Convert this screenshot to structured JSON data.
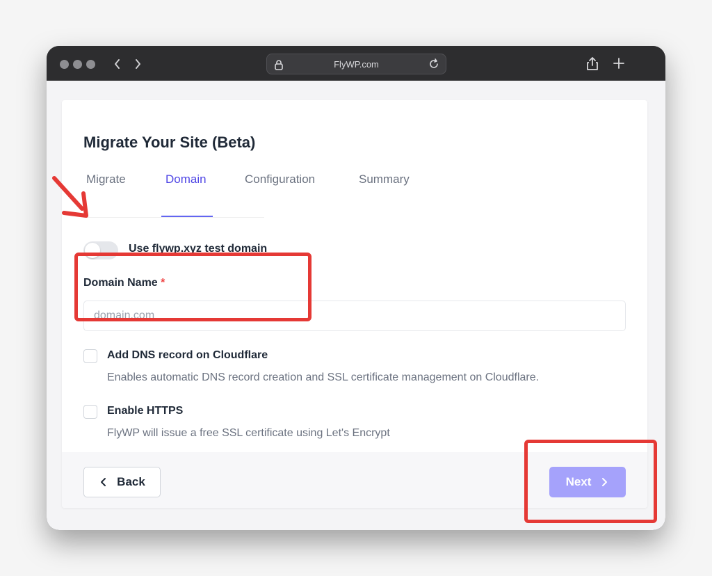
{
  "browser": {
    "url": "FlyWP.com",
    "icons": {
      "back": "chevron-left-icon",
      "forward": "chevron-right-icon",
      "lock": "lock-icon",
      "reload": "reload-icon",
      "share": "share-icon",
      "new_tab": "plus-icon",
      "tabs": "tabs-icon"
    }
  },
  "page": {
    "title": "Migrate Your Site (Beta)",
    "tabs": [
      {
        "label": "Migrate",
        "active": false
      },
      {
        "label": "Domain",
        "active": true
      },
      {
        "label": "Configuration",
        "active": false
      },
      {
        "label": "Summary",
        "active": false
      }
    ],
    "test_domain_toggle": {
      "label": "Use flywp.xyz test domain",
      "on": false
    },
    "domain_field": {
      "label": "Domain Name",
      "required_mark": "*",
      "placeholder": "domain.com",
      "value": ""
    },
    "options": [
      {
        "title": "Add DNS record on Cloudflare",
        "description": "Enables automatic DNS record creation and SSL certificate management on Cloudflare.",
        "checked": false
      },
      {
        "title": "Enable HTTPS",
        "description": "FlyWP will issue a free SSL certificate using Let's Encrypt",
        "checked": false
      }
    ],
    "footer": {
      "back_label": "Back",
      "next_label": "Next"
    }
  },
  "colors": {
    "accent": "#4f46e5",
    "next_button": "#a5a2fb",
    "annotation": "#e53935",
    "required": "#ef4444"
  }
}
